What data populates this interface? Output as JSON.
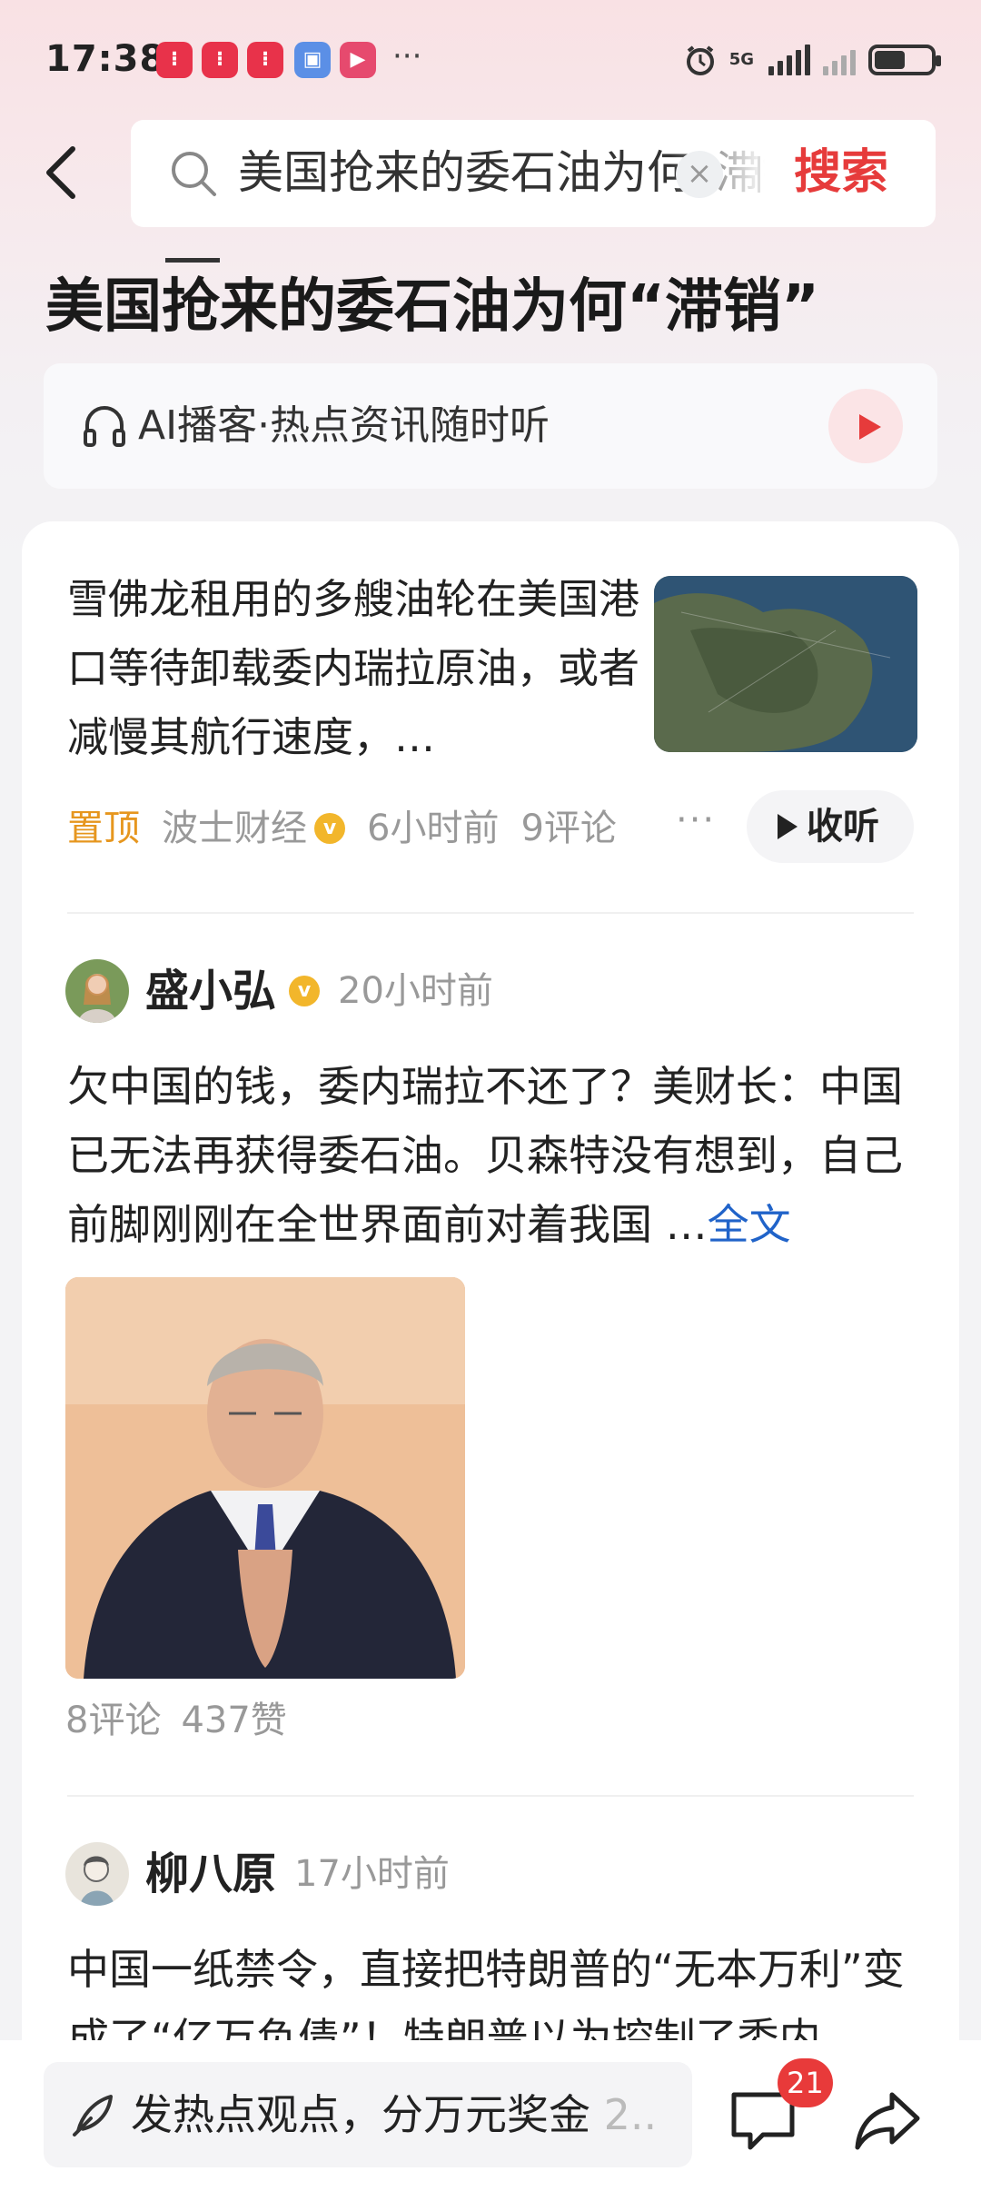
{
  "status_bar": {
    "time": "17:38",
    "app_icons": [
      "app-icon",
      "app-icon",
      "app-icon",
      "app-icon",
      "app-icon"
    ],
    "more": "···",
    "network": "5G",
    "battery_level": 0.55
  },
  "search": {
    "query": "美国抢来的委石油为何“滞销”",
    "clear": "×",
    "submit_label": "搜索"
  },
  "page": {
    "title": "美国抢来的委石油为何“滞销”"
  },
  "podcast": {
    "label": "AI播客·热点资讯随时听"
  },
  "news": {
    "text": "雪佛龙租用的多艘油轮在美国港口等待卸载委内瑞拉原油，或者减慢其航行速度，…",
    "tag": "置顶",
    "source": "波士财经",
    "verified_mark": "v",
    "time": "6小时前",
    "comments": "9评论",
    "more": "···",
    "listen_label": "收听"
  },
  "posts": [
    {
      "author": "盛小弘",
      "verified_mark": "v",
      "time": "20小时前",
      "text": "欠中国的钱，委内瑞拉不还了？美财长：中国已无法再获得委石油。贝森特没有想到，自己前脚刚刚在全世界面前对着我国 …",
      "full_link": "全文",
      "comments": "8评论",
      "likes": "437赞"
    },
    {
      "author": "柳八原",
      "time": "17小时前",
      "text": "中国一纸禁令，直接把特朗普的“无本万利”变成了“亿万负债”！特朗普以为控制了委内"
    }
  ],
  "bottom_bar": {
    "input_text": "发热点观点，分万元奖金",
    "input_fade": "2..",
    "comment_count": "21"
  },
  "colors": {
    "accent": "#e63b3b",
    "link": "#2063c9",
    "tag": "#e6961e",
    "verified": "#f2b62b"
  }
}
